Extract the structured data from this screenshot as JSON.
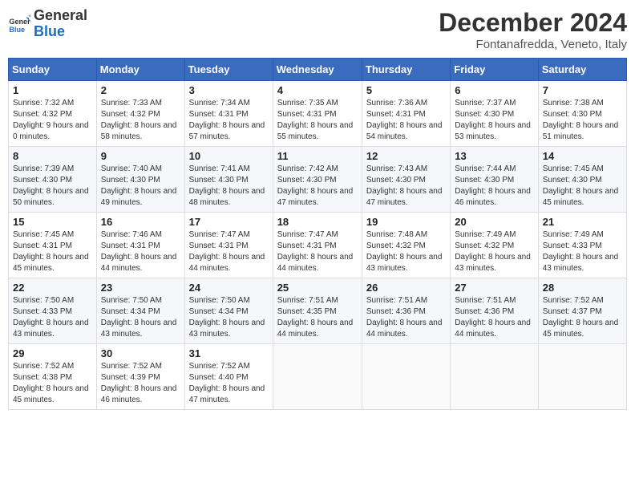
{
  "header": {
    "logo_general": "General",
    "logo_blue": "Blue",
    "month_title": "December 2024",
    "location": "Fontanafredda, Veneto, Italy"
  },
  "weekdays": [
    "Sunday",
    "Monday",
    "Tuesday",
    "Wednesday",
    "Thursday",
    "Friday",
    "Saturday"
  ],
  "weeks": [
    [
      {
        "day": "1",
        "sunrise": "Sunrise: 7:32 AM",
        "sunset": "Sunset: 4:32 PM",
        "daylight": "Daylight: 9 hours and 0 minutes."
      },
      {
        "day": "2",
        "sunrise": "Sunrise: 7:33 AM",
        "sunset": "Sunset: 4:32 PM",
        "daylight": "Daylight: 8 hours and 58 minutes."
      },
      {
        "day": "3",
        "sunrise": "Sunrise: 7:34 AM",
        "sunset": "Sunset: 4:31 PM",
        "daylight": "Daylight: 8 hours and 57 minutes."
      },
      {
        "day": "4",
        "sunrise": "Sunrise: 7:35 AM",
        "sunset": "Sunset: 4:31 PM",
        "daylight": "Daylight: 8 hours and 55 minutes."
      },
      {
        "day": "5",
        "sunrise": "Sunrise: 7:36 AM",
        "sunset": "Sunset: 4:31 PM",
        "daylight": "Daylight: 8 hours and 54 minutes."
      },
      {
        "day": "6",
        "sunrise": "Sunrise: 7:37 AM",
        "sunset": "Sunset: 4:30 PM",
        "daylight": "Daylight: 8 hours and 53 minutes."
      },
      {
        "day": "7",
        "sunrise": "Sunrise: 7:38 AM",
        "sunset": "Sunset: 4:30 PM",
        "daylight": "Daylight: 8 hours and 51 minutes."
      }
    ],
    [
      {
        "day": "8",
        "sunrise": "Sunrise: 7:39 AM",
        "sunset": "Sunset: 4:30 PM",
        "daylight": "Daylight: 8 hours and 50 minutes."
      },
      {
        "day": "9",
        "sunrise": "Sunrise: 7:40 AM",
        "sunset": "Sunset: 4:30 PM",
        "daylight": "Daylight: 8 hours and 49 minutes."
      },
      {
        "day": "10",
        "sunrise": "Sunrise: 7:41 AM",
        "sunset": "Sunset: 4:30 PM",
        "daylight": "Daylight: 8 hours and 48 minutes."
      },
      {
        "day": "11",
        "sunrise": "Sunrise: 7:42 AM",
        "sunset": "Sunset: 4:30 PM",
        "daylight": "Daylight: 8 hours and 47 minutes."
      },
      {
        "day": "12",
        "sunrise": "Sunrise: 7:43 AM",
        "sunset": "Sunset: 4:30 PM",
        "daylight": "Daylight: 8 hours and 47 minutes."
      },
      {
        "day": "13",
        "sunrise": "Sunrise: 7:44 AM",
        "sunset": "Sunset: 4:30 PM",
        "daylight": "Daylight: 8 hours and 46 minutes."
      },
      {
        "day": "14",
        "sunrise": "Sunrise: 7:45 AM",
        "sunset": "Sunset: 4:30 PM",
        "daylight": "Daylight: 8 hours and 45 minutes."
      }
    ],
    [
      {
        "day": "15",
        "sunrise": "Sunrise: 7:45 AM",
        "sunset": "Sunset: 4:31 PM",
        "daylight": "Daylight: 8 hours and 45 minutes."
      },
      {
        "day": "16",
        "sunrise": "Sunrise: 7:46 AM",
        "sunset": "Sunset: 4:31 PM",
        "daylight": "Daylight: 8 hours and 44 minutes."
      },
      {
        "day": "17",
        "sunrise": "Sunrise: 7:47 AM",
        "sunset": "Sunset: 4:31 PM",
        "daylight": "Daylight: 8 hours and 44 minutes."
      },
      {
        "day": "18",
        "sunrise": "Sunrise: 7:47 AM",
        "sunset": "Sunset: 4:31 PM",
        "daylight": "Daylight: 8 hours and 44 minutes."
      },
      {
        "day": "19",
        "sunrise": "Sunrise: 7:48 AM",
        "sunset": "Sunset: 4:32 PM",
        "daylight": "Daylight: 8 hours and 43 minutes."
      },
      {
        "day": "20",
        "sunrise": "Sunrise: 7:49 AM",
        "sunset": "Sunset: 4:32 PM",
        "daylight": "Daylight: 8 hours and 43 minutes."
      },
      {
        "day": "21",
        "sunrise": "Sunrise: 7:49 AM",
        "sunset": "Sunset: 4:33 PM",
        "daylight": "Daylight: 8 hours and 43 minutes."
      }
    ],
    [
      {
        "day": "22",
        "sunrise": "Sunrise: 7:50 AM",
        "sunset": "Sunset: 4:33 PM",
        "daylight": "Daylight: 8 hours and 43 minutes."
      },
      {
        "day": "23",
        "sunrise": "Sunrise: 7:50 AM",
        "sunset": "Sunset: 4:34 PM",
        "daylight": "Daylight: 8 hours and 43 minutes."
      },
      {
        "day": "24",
        "sunrise": "Sunrise: 7:50 AM",
        "sunset": "Sunset: 4:34 PM",
        "daylight": "Daylight: 8 hours and 43 minutes."
      },
      {
        "day": "25",
        "sunrise": "Sunrise: 7:51 AM",
        "sunset": "Sunset: 4:35 PM",
        "daylight": "Daylight: 8 hours and 44 minutes."
      },
      {
        "day": "26",
        "sunrise": "Sunrise: 7:51 AM",
        "sunset": "Sunset: 4:36 PM",
        "daylight": "Daylight: 8 hours and 44 minutes."
      },
      {
        "day": "27",
        "sunrise": "Sunrise: 7:51 AM",
        "sunset": "Sunset: 4:36 PM",
        "daylight": "Daylight: 8 hours and 44 minutes."
      },
      {
        "day": "28",
        "sunrise": "Sunrise: 7:52 AM",
        "sunset": "Sunset: 4:37 PM",
        "daylight": "Daylight: 8 hours and 45 minutes."
      }
    ],
    [
      {
        "day": "29",
        "sunrise": "Sunrise: 7:52 AM",
        "sunset": "Sunset: 4:38 PM",
        "daylight": "Daylight: 8 hours and 45 minutes."
      },
      {
        "day": "30",
        "sunrise": "Sunrise: 7:52 AM",
        "sunset": "Sunset: 4:39 PM",
        "daylight": "Daylight: 8 hours and 46 minutes."
      },
      {
        "day": "31",
        "sunrise": "Sunrise: 7:52 AM",
        "sunset": "Sunset: 4:40 PM",
        "daylight": "Daylight: 8 hours and 47 minutes."
      },
      null,
      null,
      null,
      null
    ]
  ]
}
